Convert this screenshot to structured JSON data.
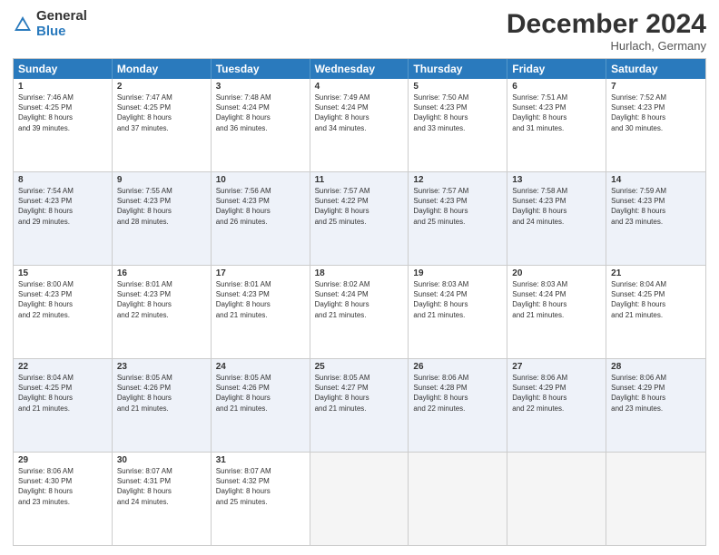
{
  "header": {
    "logo_general": "General",
    "logo_blue": "Blue",
    "month_title": "December 2024",
    "location": "Hurlach, Germany"
  },
  "weekdays": [
    "Sunday",
    "Monday",
    "Tuesday",
    "Wednesday",
    "Thursday",
    "Friday",
    "Saturday"
  ],
  "weeks": [
    [
      {
        "day": "1",
        "info": "Sunrise: 7:46 AM\nSunset: 4:25 PM\nDaylight: 8 hours\nand 39 minutes."
      },
      {
        "day": "2",
        "info": "Sunrise: 7:47 AM\nSunset: 4:25 PM\nDaylight: 8 hours\nand 37 minutes."
      },
      {
        "day": "3",
        "info": "Sunrise: 7:48 AM\nSunset: 4:24 PM\nDaylight: 8 hours\nand 36 minutes."
      },
      {
        "day": "4",
        "info": "Sunrise: 7:49 AM\nSunset: 4:24 PM\nDaylight: 8 hours\nand 34 minutes."
      },
      {
        "day": "5",
        "info": "Sunrise: 7:50 AM\nSunset: 4:23 PM\nDaylight: 8 hours\nand 33 minutes."
      },
      {
        "day": "6",
        "info": "Sunrise: 7:51 AM\nSunset: 4:23 PM\nDaylight: 8 hours\nand 31 minutes."
      },
      {
        "day": "7",
        "info": "Sunrise: 7:52 AM\nSunset: 4:23 PM\nDaylight: 8 hours\nand 30 minutes."
      }
    ],
    [
      {
        "day": "8",
        "info": "Sunrise: 7:54 AM\nSunset: 4:23 PM\nDaylight: 8 hours\nand 29 minutes."
      },
      {
        "day": "9",
        "info": "Sunrise: 7:55 AM\nSunset: 4:23 PM\nDaylight: 8 hours\nand 28 minutes."
      },
      {
        "day": "10",
        "info": "Sunrise: 7:56 AM\nSunset: 4:23 PM\nDaylight: 8 hours\nand 26 minutes."
      },
      {
        "day": "11",
        "info": "Sunrise: 7:57 AM\nSunset: 4:22 PM\nDaylight: 8 hours\nand 25 minutes."
      },
      {
        "day": "12",
        "info": "Sunrise: 7:57 AM\nSunset: 4:23 PM\nDaylight: 8 hours\nand 25 minutes."
      },
      {
        "day": "13",
        "info": "Sunrise: 7:58 AM\nSunset: 4:23 PM\nDaylight: 8 hours\nand 24 minutes."
      },
      {
        "day": "14",
        "info": "Sunrise: 7:59 AM\nSunset: 4:23 PM\nDaylight: 8 hours\nand 23 minutes."
      }
    ],
    [
      {
        "day": "15",
        "info": "Sunrise: 8:00 AM\nSunset: 4:23 PM\nDaylight: 8 hours\nand 22 minutes."
      },
      {
        "day": "16",
        "info": "Sunrise: 8:01 AM\nSunset: 4:23 PM\nDaylight: 8 hours\nand 22 minutes."
      },
      {
        "day": "17",
        "info": "Sunrise: 8:01 AM\nSunset: 4:23 PM\nDaylight: 8 hours\nand 21 minutes."
      },
      {
        "day": "18",
        "info": "Sunrise: 8:02 AM\nSunset: 4:24 PM\nDaylight: 8 hours\nand 21 minutes."
      },
      {
        "day": "19",
        "info": "Sunrise: 8:03 AM\nSunset: 4:24 PM\nDaylight: 8 hours\nand 21 minutes."
      },
      {
        "day": "20",
        "info": "Sunrise: 8:03 AM\nSunset: 4:24 PM\nDaylight: 8 hours\nand 21 minutes."
      },
      {
        "day": "21",
        "info": "Sunrise: 8:04 AM\nSunset: 4:25 PM\nDaylight: 8 hours\nand 21 minutes."
      }
    ],
    [
      {
        "day": "22",
        "info": "Sunrise: 8:04 AM\nSunset: 4:25 PM\nDaylight: 8 hours\nand 21 minutes."
      },
      {
        "day": "23",
        "info": "Sunrise: 8:05 AM\nSunset: 4:26 PM\nDaylight: 8 hours\nand 21 minutes."
      },
      {
        "day": "24",
        "info": "Sunrise: 8:05 AM\nSunset: 4:26 PM\nDaylight: 8 hours\nand 21 minutes."
      },
      {
        "day": "25",
        "info": "Sunrise: 8:05 AM\nSunset: 4:27 PM\nDaylight: 8 hours\nand 21 minutes."
      },
      {
        "day": "26",
        "info": "Sunrise: 8:06 AM\nSunset: 4:28 PM\nDaylight: 8 hours\nand 22 minutes."
      },
      {
        "day": "27",
        "info": "Sunrise: 8:06 AM\nSunset: 4:29 PM\nDaylight: 8 hours\nand 22 minutes."
      },
      {
        "day": "28",
        "info": "Sunrise: 8:06 AM\nSunset: 4:29 PM\nDaylight: 8 hours\nand 23 minutes."
      }
    ],
    [
      {
        "day": "29",
        "info": "Sunrise: 8:06 AM\nSunset: 4:30 PM\nDaylight: 8 hours\nand 23 minutes."
      },
      {
        "day": "30",
        "info": "Sunrise: 8:07 AM\nSunset: 4:31 PM\nDaylight: 8 hours\nand 24 minutes."
      },
      {
        "day": "31",
        "info": "Sunrise: 8:07 AM\nSunset: 4:32 PM\nDaylight: 8 hours\nand 25 minutes."
      },
      {
        "day": "",
        "info": ""
      },
      {
        "day": "",
        "info": ""
      },
      {
        "day": "",
        "info": ""
      },
      {
        "day": "",
        "info": ""
      }
    ]
  ]
}
